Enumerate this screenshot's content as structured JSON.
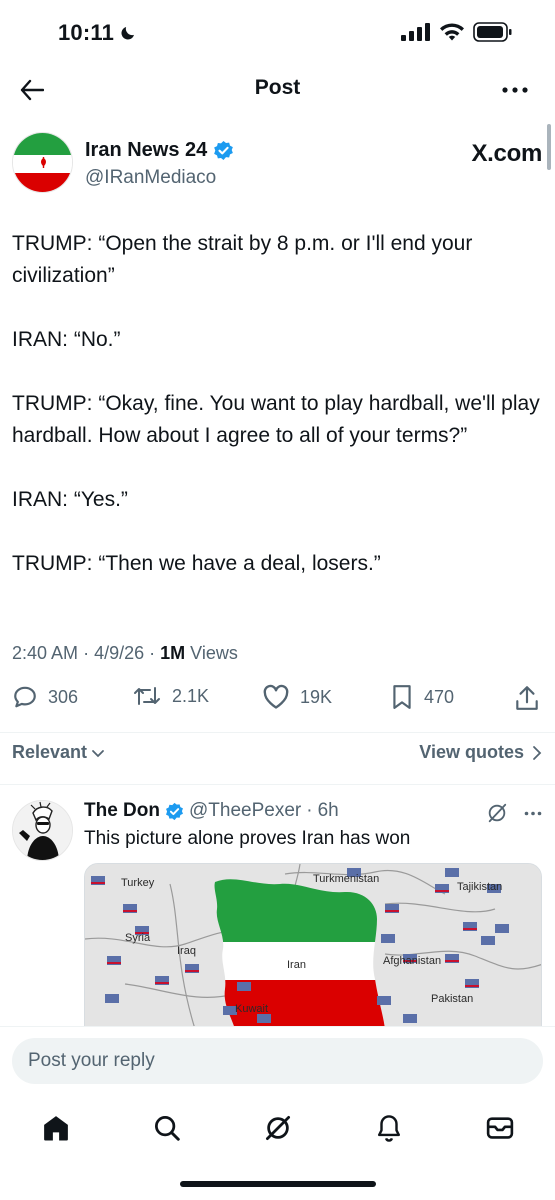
{
  "status_bar": {
    "time": "10:11"
  },
  "nav": {
    "title": "Post"
  },
  "author": {
    "name": "Iran News 24",
    "handle": "@IRanMediaco",
    "source": "X.com"
  },
  "tweet": {
    "paragraphs": [
      "TRUMP: “Open the strait by 8 p.m. or I'll end your civilization”",
      "IRAN: “No.”",
      "TRUMP: “Okay, fine. You want to play hardball, we'll play hardball. How about I agree to all of your terms?”",
      "IRAN: “Yes.”",
      "TRUMP: “Then we have a deal, losers.”"
    ],
    "time": "2:40 AM",
    "date": "4/9/26",
    "views_count": "1M",
    "views_label": "Views"
  },
  "actions": {
    "replies": "306",
    "reposts": "2.1K",
    "likes": "19K",
    "bookmarks": "470"
  },
  "sort": {
    "label": "Relevant",
    "view_quotes": "View quotes"
  },
  "reply": {
    "name": "The Don",
    "handle": "@TheePexer",
    "separator": "·",
    "time": "6h",
    "text": "This picture alone proves Iran has won",
    "map_labels": {
      "turkey": "Turkey",
      "turkmenistan": "Turkmenistan",
      "tajikistan": "Tajikistan",
      "syria": "Syria",
      "iraq": "Iraq",
      "iran": "Iran",
      "afghanistan": "Afghanistan",
      "pakistan": "Pakistan",
      "kuwait": "Kuwait"
    }
  },
  "reply_bar": {
    "placeholder": "Post your reply"
  },
  "colors": {
    "verified_blue": "#1d9bf0",
    "text": "#0f1419",
    "secondary": "#536471",
    "iran_green": "#239f40",
    "iran_red": "#da0000"
  },
  "icons": [
    "back-arrow-icon",
    "more-icon",
    "verified-badge-icon",
    "reply-icon",
    "repost-icon",
    "like-icon",
    "bookmark-icon",
    "share-icon",
    "chevron-down-icon",
    "chevron-right-icon",
    "grok-icon",
    "home-icon",
    "search-icon",
    "notifications-icon",
    "messages-icon"
  ]
}
